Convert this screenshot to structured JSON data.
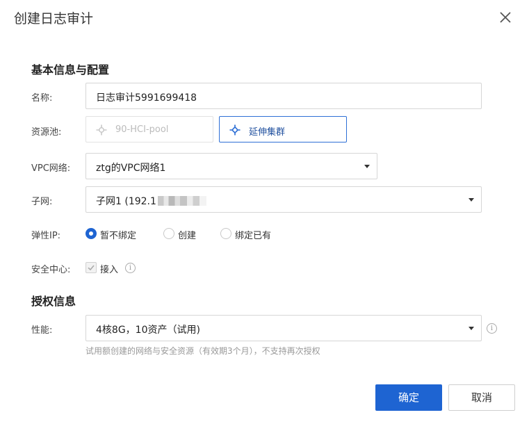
{
  "dialog": {
    "title": "创建日志审计"
  },
  "basic": {
    "section_title": "基本信息与配置",
    "name_label": "名称:",
    "name_value": "日志审计5991699418",
    "pool_label": "资源池:",
    "pool_option_disabled": "90-HCI-pool",
    "pool_option_active": "延伸集群",
    "vpc_label": "VPC网络:",
    "vpc_value": "ztg的VPC网络1",
    "subnet_label": "子网:",
    "subnet_value": "子网1 (192.1",
    "eip_label": "弹性IP:",
    "eip_options": [
      "暂不绑定",
      "创建",
      "绑定已有"
    ],
    "eip_selected": "暂不绑定",
    "security_label": "安全中心:",
    "security_checkbox_label": "接入",
    "security_checked": true
  },
  "license": {
    "section_title": "授权信息",
    "perf_label": "性能:",
    "perf_value": "4核8G，10资产（试用)",
    "help_text": "试用额创建的网络与安全资源（有效期3个月），不支持再次授权"
  },
  "footer": {
    "confirm_label": "确定",
    "cancel_label": "取消"
  },
  "colors": {
    "primary": "#1e64d2",
    "active_border": "#2d6fd6"
  }
}
